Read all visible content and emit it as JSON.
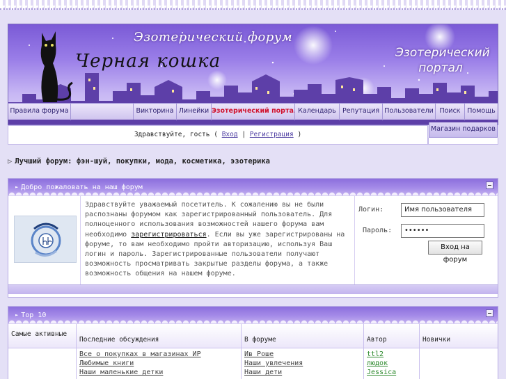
{
  "banner": {
    "title": "Эзотерический форум",
    "logo_text": "Черная кошка",
    "portal_text_1": "Эзотерический",
    "portal_text_2": "портал"
  },
  "nav": {
    "items": [
      {
        "label": "Правила форума"
      },
      {
        "label": "Викторина"
      },
      {
        "label": "Линейки"
      },
      {
        "label": "Эзотерический портал",
        "active": true
      },
      {
        "label": "Календарь"
      },
      {
        "label": "Репутация"
      },
      {
        "label": "Пользователи"
      },
      {
        "label": "Поиск"
      },
      {
        "label": "Помощь"
      }
    ],
    "shop": "Магазин подарков"
  },
  "greeting": {
    "text": "Здравствуйте, гость",
    "open_paren": "(",
    "login": "Вход",
    "sep": "|",
    "register": "Регистрация",
    "close_paren": ")"
  },
  "forum_description": {
    "arrow": "▷",
    "text": "Лучший форум: фэн-шуй, покупки, мода, косметика, эзотерика"
  },
  "welcome": {
    "title": "Добро пожаловать на наш форум",
    "text_1": "Здравствуйте уважаемый посетитель. К сожалению вы не были распознаны форумом как зарегистрированный пользователь. Для полноценного использования возможностей нашего форума вам необходимо",
    "register_link": "зарегистрироваться",
    "text_2": ". Если вы уже зарегистрированы на форуме, то вам необходимо пройти авторизацию, используя Ваш логин и пароль. Зарегистрированные пользователи получают возможность просматривать закрытые разделы форума, а также возможность общения на нашем форуме.",
    "login_label": "Логин:",
    "login_value": "Имя пользователя",
    "password_label": "Пароль:",
    "password_value": "••••••",
    "login_button": "Вход на форум"
  },
  "top10": {
    "title": "Top 10",
    "columns": {
      "active": "Самые активные",
      "latest": "Последние обсуждения",
      "in_forum": "В форуме",
      "author": "Автор",
      "newbies": "Новички"
    },
    "rows": [
      {
        "topic": "Все о покупках в магазинах ИР",
        "forum": "Ив Роше",
        "author": "ttl2"
      },
      {
        "topic": "Любимые книги",
        "forum": "Наши увлечения",
        "author": "людок"
      },
      {
        "topic": "Наши маленькие детки",
        "forum": "Наши дети",
        "author": "Jessica"
      }
    ]
  },
  "colors": {
    "accent": "#8c6fdd",
    "active_nav": "#d0122e",
    "author_link": "#2e8a2e"
  }
}
